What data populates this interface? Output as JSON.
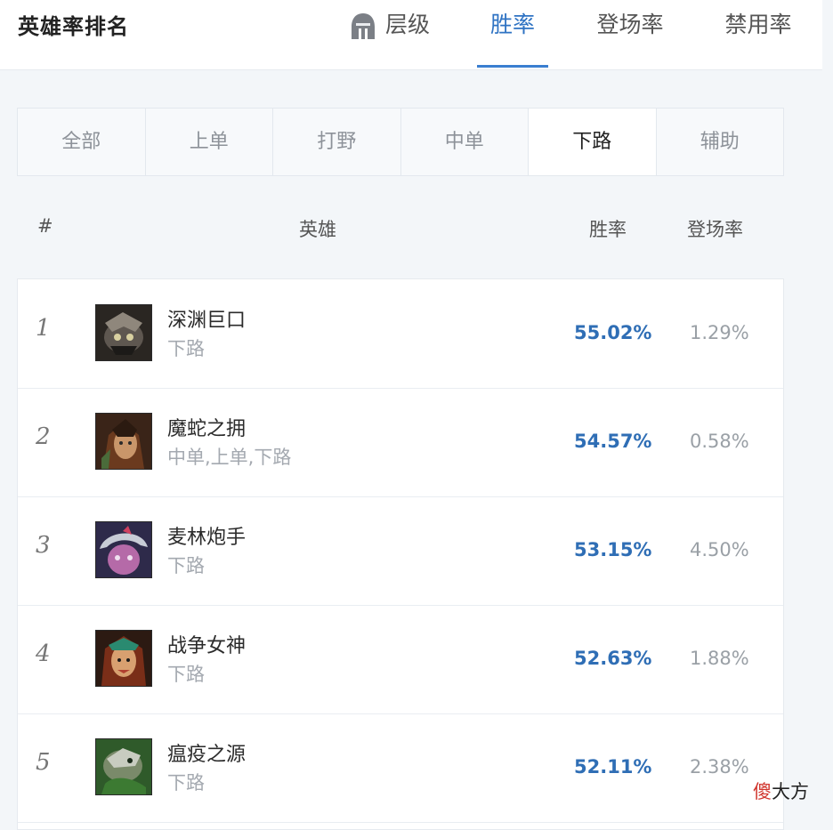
{
  "header": {
    "title": "英雄率排名",
    "tabs": [
      {
        "label": "层级",
        "icon": "helmet-icon"
      },
      {
        "label": "胜率",
        "active": true
      },
      {
        "label": "登场率"
      },
      {
        "label": "禁用率"
      }
    ]
  },
  "filters": [
    "全部",
    "上单",
    "打野",
    "中单",
    "下路",
    "辅助"
  ],
  "active_filter": "下路",
  "columns": {
    "rank": "#",
    "hero": "英雄",
    "win": "胜率",
    "pick": "登场率"
  },
  "rows": [
    {
      "rank": "1",
      "name": "深渊巨口",
      "role": "下路",
      "win": "55.02%",
      "pick": "1.29%"
    },
    {
      "rank": "2",
      "name": "魔蛇之拥",
      "role": "中单,上单,下路",
      "win": "54.57%",
      "pick": "0.58%"
    },
    {
      "rank": "3",
      "name": "麦林炮手",
      "role": "下路",
      "win": "53.15%",
      "pick": "4.50%"
    },
    {
      "rank": "4",
      "name": "战争女神",
      "role": "下路",
      "win": "52.63%",
      "pick": "1.88%"
    },
    {
      "rank": "5",
      "name": "瘟疫之源",
      "role": "下路",
      "win": "52.11%",
      "pick": "2.38%"
    }
  ],
  "watermark": {
    "part1": "傻",
    "part2": "大方"
  },
  "colors": {
    "accent": "#2f73c3",
    "win_rate": "#2f6eb5",
    "muted": "#9aa0a6"
  }
}
